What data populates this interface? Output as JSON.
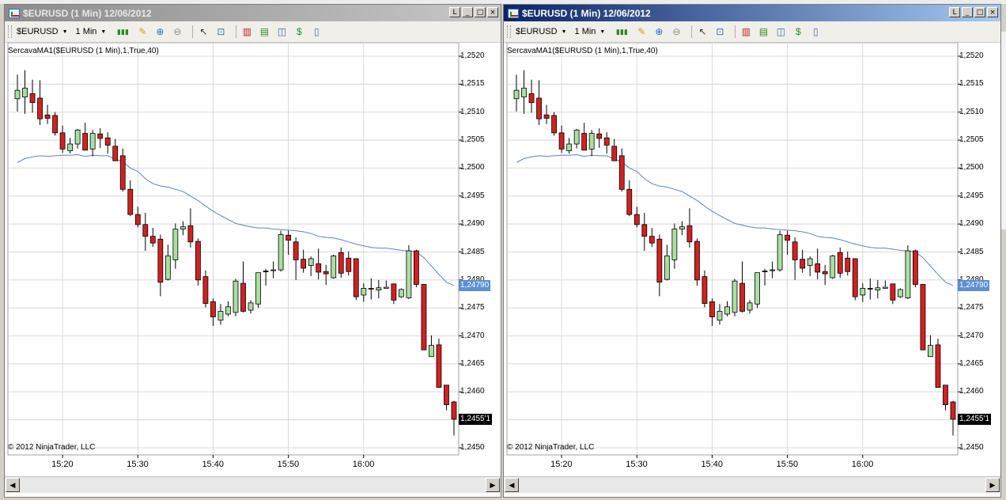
{
  "windows": [
    {
      "title": "$EURUSD (1 Min)  12/06/2012",
      "state": "inactive",
      "title_buttons": [
        "L",
        "_",
        "□",
        "×"
      ],
      "toolbar": {
        "instrument": "$EURUSD",
        "interval": "1 Min"
      },
      "indicator_label": "SercavaMA1($EURUSD (1 Min),1,True,40)",
      "copyright": "© 2012 NinjaTrader, LLC",
      "price_boxes": {
        "ma": "1,24790",
        "last": "1,2455'1"
      },
      "scroll_left": "◀",
      "scroll_right": "▶"
    },
    {
      "title": "$EURUSD (1 Min)  12/06/2012",
      "state": "active",
      "title_buttons": [
        "L",
        "_",
        "□",
        "×"
      ],
      "toolbar": {
        "instrument": "$EURUSD",
        "interval": "1 Min"
      },
      "indicator_label": "SercavaMA1($EURUSD (1 Min),1,True,40)",
      "copyright": "© 2012 NinjaTrader, LLC",
      "price_boxes": {
        "ma": "1,24790",
        "last": "1,2455'1"
      },
      "scroll_left": "◀",
      "scroll_right": "▶"
    }
  ],
  "toolbar_icons": [
    "bar-type-icon",
    "drawing-pencil-icon",
    "zoom-in-icon",
    "zoom-out-icon",
    "cursor-icon",
    "data-box-icon",
    "indicators-icon",
    "strategies-icon",
    "chart-properties-icon",
    "order-icon",
    "template-icon"
  ],
  "colors": {
    "up_candle": "#a8e0a0",
    "down_candle": "#d42020",
    "ma_line": "#5b7fcf",
    "grid": "#d8d8d8",
    "ma_box": "#5b8fd6",
    "last_box": "#000000"
  },
  "chart_data": {
    "type": "candlestick",
    "x_tick_labels": [
      "15:20",
      "15:30",
      "15:40",
      "15:50",
      "16:00"
    ],
    "y_tick_labels": [
      "1,2520",
      "1,2515",
      "1,2510",
      "1,2505",
      "1,2500",
      "1,2495",
      "1,2490",
      "1,2485",
      "1,2480",
      "1,2475",
      "1,2470",
      "1,2465",
      "1,2460",
      "1,2455",
      "1,2450"
    ],
    "ylim": [
      1.2447,
      1.2522
    ],
    "candles": [
      {
        "o": 1.25124,
        "h": 1.25167,
        "l": 1.25101,
        "c": 1.25139
      },
      {
        "o": 1.25127,
        "h": 1.25175,
        "l": 1.25097,
        "c": 1.25143
      },
      {
        "o": 1.25133,
        "h": 1.25158,
        "l": 1.25099,
        "c": 1.25117
      },
      {
        "o": 1.25125,
        "h": 1.25157,
        "l": 1.25077,
        "c": 1.25088
      },
      {
        "o": 1.25095,
        "h": 1.25113,
        "l": 1.25079,
        "c": 1.25089
      },
      {
        "o": 1.25094,
        "h": 1.251,
        "l": 1.25058,
        "c": 1.25063
      },
      {
        "o": 1.25063,
        "h": 1.25076,
        "l": 1.25027,
        "c": 1.25034
      },
      {
        "o": 1.25031,
        "h": 1.25054,
        "l": 1.25026,
        "c": 1.25043
      },
      {
        "o": 1.25043,
        "h": 1.2507,
        "l": 1.25035,
        "c": 1.25068
      },
      {
        "o": 1.25062,
        "h": 1.25081,
        "l": 1.25035,
        "c": 1.25032
      },
      {
        "o": 1.25034,
        "h": 1.25068,
        "l": 1.25021,
        "c": 1.25062
      },
      {
        "o": 1.25061,
        "h": 1.25071,
        "l": 1.25036,
        "c": 1.25053
      },
      {
        "o": 1.25054,
        "h": 1.25064,
        "l": 1.25026,
        "c": 1.25041
      },
      {
        "o": 1.25039,
        "h": 1.25052,
        "l": 1.25022,
        "c": 1.25013
      },
      {
        "o": 1.25022,
        "h": 1.25035,
        "l": 1.24958,
        "c": 1.24962
      },
      {
        "o": 1.24962,
        "h": 1.24978,
        "l": 1.24914,
        "c": 1.24917
      },
      {
        "o": 1.24917,
        "h": 1.24931,
        "l": 1.24894,
        "c": 1.24899
      },
      {
        "o": 1.24899,
        "h": 1.2492,
        "l": 1.24852,
        "c": 1.24878
      },
      {
        "o": 1.24878,
        "h": 1.24893,
        "l": 1.24859,
        "c": 1.24866
      },
      {
        "o": 1.24873,
        "h": 1.24881,
        "l": 1.24771,
        "c": 1.24796
      },
      {
        "o": 1.24801,
        "h": 1.24863,
        "l": 1.24799,
        "c": 1.24843
      },
      {
        "o": 1.24836,
        "h": 1.24901,
        "l": 1.2482,
        "c": 1.24891
      },
      {
        "o": 1.24891,
        "h": 1.24905,
        "l": 1.2488,
        "c": 1.24895
      },
      {
        "o": 1.24897,
        "h": 1.24928,
        "l": 1.24858,
        "c": 1.24868
      },
      {
        "o": 1.24869,
        "h": 1.24874,
        "l": 1.2479,
        "c": 1.248
      },
      {
        "o": 1.24806,
        "h": 1.24817,
        "l": 1.24751,
        "c": 1.24758
      },
      {
        "o": 1.24761,
        "h": 1.24767,
        "l": 1.24718,
        "c": 1.24734
      },
      {
        "o": 1.24728,
        "h": 1.24757,
        "l": 1.2472,
        "c": 1.24744
      },
      {
        "o": 1.24739,
        "h": 1.24762,
        "l": 1.24735,
        "c": 1.24752
      },
      {
        "o": 1.24742,
        "h": 1.24802,
        "l": 1.24735,
        "c": 1.24798
      },
      {
        "o": 1.24794,
        "h": 1.24833,
        "l": 1.24742,
        "c": 1.24744
      },
      {
        "o": 1.24746,
        "h": 1.24764,
        "l": 1.2474,
        "c": 1.24759
      },
      {
        "o": 1.24757,
        "h": 1.2481,
        "l": 1.2475,
        "c": 1.24813
      },
      {
        "o": 1.24816,
        "h": 1.2482,
        "l": 1.2479,
        "c": 1.24815
      },
      {
        "o": 1.24818,
        "h": 1.24833,
        "l": 1.24803,
        "c": 1.24818
      },
      {
        "o": 1.24818,
        "h": 1.24888,
        "l": 1.24815,
        "c": 1.24881
      },
      {
        "o": 1.2488,
        "h": 1.24888,
        "l": 1.24845,
        "c": 1.24871
      },
      {
        "o": 1.24868,
        "h": 1.24876,
        "l": 1.248,
        "c": 1.24836
      },
      {
        "o": 1.24837,
        "h": 1.24854,
        "l": 1.24813,
        "c": 1.24821
      },
      {
        "o": 1.24826,
        "h": 1.24842,
        "l": 1.24807,
        "c": 1.24838
      },
      {
        "o": 1.24829,
        "h": 1.24856,
        "l": 1.24801,
        "c": 1.24814
      },
      {
        "o": 1.24815,
        "h": 1.24827,
        "l": 1.24791,
        "c": 1.24811
      },
      {
        "o": 1.24804,
        "h": 1.24845,
        "l": 1.24802,
        "c": 1.24843
      },
      {
        "o": 1.24849,
        "h": 1.24858,
        "l": 1.24804,
        "c": 1.24812
      },
      {
        "o": 1.24839,
        "h": 1.24851,
        "l": 1.24808,
        "c": 1.24815
      },
      {
        "o": 1.24838,
        "h": 1.24838,
        "l": 1.24764,
        "c": 1.2477
      },
      {
        "o": 1.24773,
        "h": 1.24794,
        "l": 1.24761,
        "c": 1.24785
      },
      {
        "o": 1.24785,
        "h": 1.24803,
        "l": 1.24765,
        "c": 1.24784
      },
      {
        "o": 1.24782,
        "h": 1.248,
        "l": 1.24767,
        "c": 1.24786
      },
      {
        "o": 1.24785,
        "h": 1.24799,
        "l": 1.24788,
        "c": 1.24787
      },
      {
        "o": 1.24793,
        "h": 1.24793,
        "l": 1.24757,
        "c": 1.24764
      },
      {
        "o": 1.2477,
        "h": 1.24785,
        "l": 1.24768,
        "c": 1.24783
      },
      {
        "o": 1.24768,
        "h": 1.24862,
        "l": 1.24766,
        "c": 1.24852
      },
      {
        "o": 1.24852,
        "h": 1.24854,
        "l": 1.24787,
        "c": 1.24792
      },
      {
        "o": 1.24792,
        "h": 1.24793,
        "l": 1.2469,
        "c": 1.24675
      },
      {
        "o": 1.24663,
        "h": 1.24701,
        "l": 1.24664,
        "c": 1.24683
      },
      {
        "o": 1.24684,
        "h": 1.24695,
        "l": 1.24607,
        "c": 1.24608
      },
      {
        "o": 1.24612,
        "h": 1.24612,
        "l": 1.24567,
        "c": 1.24577
      },
      {
        "o": 1.24582,
        "h": 1.24584,
        "l": 1.24522,
        "c": 1.24551
      }
    ],
    "ma_series": [
      1.2501,
      1.25017,
      1.2502,
      1.25022,
      1.25021,
      1.25022,
      1.25023,
      1.25023,
      1.25024,
      1.25021,
      1.25023,
      1.25022,
      1.25022,
      1.25016,
      1.25011,
      1.25,
      1.24994,
      1.24981,
      1.24972,
      1.24968,
      1.24966,
      1.24962,
      1.24958,
      1.2495,
      1.24942,
      1.24932,
      1.24923,
      1.24915,
      1.24908,
      1.24901,
      1.24898,
      1.24895,
      1.24893,
      1.24893,
      1.24891,
      1.2489,
      1.24889,
      1.24888,
      1.24886,
      1.24883,
      1.24878,
      1.24876,
      1.24875,
      1.24872,
      1.24868,
      1.24864,
      1.24861,
      1.24858,
      1.24857,
      1.24857,
      1.24855,
      1.24853,
      1.24852,
      1.2485,
      1.2484,
      1.24825,
      1.2481,
      1.24796,
      1.2479
    ]
  }
}
